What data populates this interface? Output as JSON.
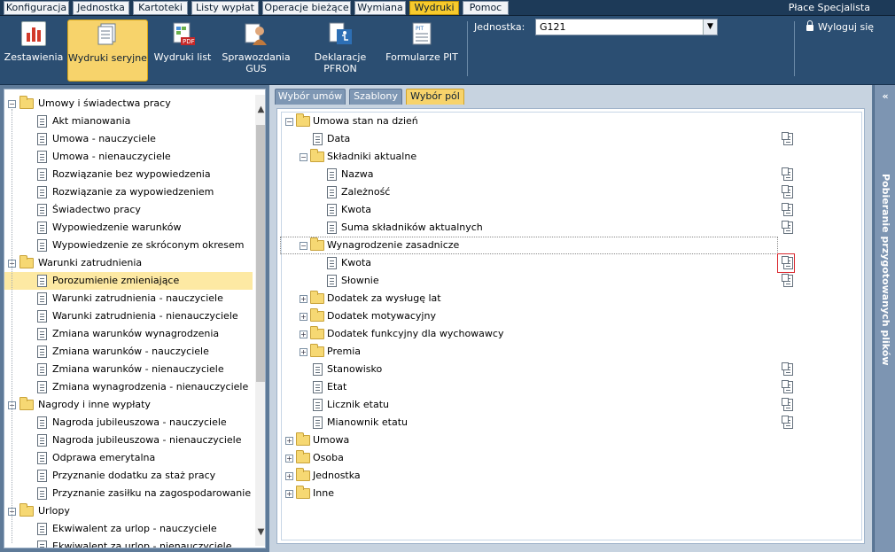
{
  "app_title": "Płace Specjalista",
  "top_menu": [
    {
      "label": "Konfiguracja",
      "active": false
    },
    {
      "label": "Jednostka",
      "active": false
    },
    {
      "label": "Kartoteki",
      "active": false
    },
    {
      "label": "Listy wypłat",
      "active": false
    },
    {
      "label": "Operacje bieżące",
      "active": false
    },
    {
      "label": "Wymiana",
      "active": false
    },
    {
      "label": "Wydruki",
      "active": true
    },
    {
      "label": "Pomoc",
      "active": false
    }
  ],
  "ribbon": {
    "buttons": [
      {
        "label": "Zestawienia",
        "icon": "bar-chart-icon",
        "active": false
      },
      {
        "label": "Wydruki seryjne",
        "icon": "document-stack-icon",
        "active": true
      },
      {
        "label": "Wydruki list",
        "icon": "pdf-document-icon",
        "active": false
      },
      {
        "label": "Sprawozdania GUS",
        "icon": "gus-report-icon",
        "active": false
      },
      {
        "label": "Deklaracje PFRON",
        "icon": "pfron-icon",
        "active": false
      },
      {
        "label": "Formularze PIT",
        "icon": "pit-form-icon",
        "active": false
      }
    ],
    "unit_label": "Jednostka:",
    "unit_value": "G121",
    "logout_label": "Wyloguj się"
  },
  "left_tree": [
    {
      "label": "Umowy i świadectwa pracy",
      "type": "folder",
      "level": 0,
      "expanded": true
    },
    {
      "label": "Akt mianowania",
      "type": "doc",
      "level": 1
    },
    {
      "label": "Umowa - nauczyciele",
      "type": "doc",
      "level": 1
    },
    {
      "label": "Umowa - nienauczyciele",
      "type": "doc",
      "level": 1
    },
    {
      "label": "Rozwiązanie bez wypowiedzenia",
      "type": "doc",
      "level": 1
    },
    {
      "label": "Rozwiązanie za wypowiedzeniem",
      "type": "doc",
      "level": 1
    },
    {
      "label": "Świadectwo pracy",
      "type": "doc",
      "level": 1
    },
    {
      "label": "Wypowiedzenie warunków",
      "type": "doc",
      "level": 1
    },
    {
      "label": "Wypowiedzenie ze skróconym okresem",
      "type": "doc",
      "level": 1
    },
    {
      "label": "Warunki zatrudnienia",
      "type": "folder",
      "level": 0,
      "expanded": true
    },
    {
      "label": "Porozumienie zmieniające",
      "type": "doc",
      "level": 1,
      "selected": true
    },
    {
      "label": "Warunki zatrudnienia - nauczyciele",
      "type": "doc",
      "level": 1
    },
    {
      "label": "Warunki zatrudnienia - nienauczyciele",
      "type": "doc",
      "level": 1
    },
    {
      "label": "Zmiana warunków wynagrodzenia",
      "type": "doc",
      "level": 1
    },
    {
      "label": "Zmiana warunków - nauczyciele",
      "type": "doc",
      "level": 1
    },
    {
      "label": "Zmiana warunków - nienauczyciele",
      "type": "doc",
      "level": 1
    },
    {
      "label": "Zmiana wynagrodzenia - nienauczyciele",
      "type": "doc",
      "level": 1
    },
    {
      "label": "Nagrody i inne wypłaty",
      "type": "folder",
      "level": 0,
      "expanded": true
    },
    {
      "label": "Nagroda jubileuszowa - nauczyciele",
      "type": "doc",
      "level": 1
    },
    {
      "label": "Nagroda jubileuszowa - nienauczyciele",
      "type": "doc",
      "level": 1
    },
    {
      "label": "Odprawa emerytalna",
      "type": "doc",
      "level": 1
    },
    {
      "label": "Przyznanie dodatku za staż pracy",
      "type": "doc",
      "level": 1
    },
    {
      "label": "Przyznanie zasiłku na zagospodarowanie",
      "type": "doc",
      "level": 1
    },
    {
      "label": "Urlopy",
      "type": "folder",
      "level": 0,
      "expanded": true
    },
    {
      "label": "Ekwiwalent za urlop - nauczyciele",
      "type": "doc",
      "level": 1
    },
    {
      "label": "Ekwiwalent za urlop - nienauczyciele",
      "type": "doc",
      "level": 1
    }
  ],
  "right_tabs": [
    {
      "label": "Wybór umów",
      "active": false
    },
    {
      "label": "Szablony",
      "active": false
    },
    {
      "label": "Wybór pól",
      "active": true
    }
  ],
  "right_tree": [
    {
      "label": "Umowa stan na dzień",
      "type": "folder",
      "level": 0,
      "expanded": true
    },
    {
      "label": "Data",
      "type": "doc",
      "level": 1,
      "action": true
    },
    {
      "label": "Składniki aktualne",
      "type": "folder",
      "level": 1,
      "expanded": true
    },
    {
      "label": "Nazwa",
      "type": "doc",
      "level": 2,
      "action": true
    },
    {
      "label": "Zależność",
      "type": "doc",
      "level": 2,
      "action": true
    },
    {
      "label": "Kwota",
      "type": "doc",
      "level": 2,
      "action": true
    },
    {
      "label": "Suma składników aktualnych",
      "type": "doc",
      "level": 2,
      "action": true
    },
    {
      "label": "Wynagrodzenie zasadnicze",
      "type": "folder",
      "level": 1,
      "expanded": true,
      "focused": true
    },
    {
      "label": "Kwota",
      "type": "doc",
      "level": 2,
      "action": true,
      "highlight_action": true
    },
    {
      "label": "Słownie",
      "type": "doc",
      "level": 2,
      "action": true
    },
    {
      "label": "Dodatek za wysługę lat",
      "type": "folder",
      "level": 1,
      "expanded": false
    },
    {
      "label": "Dodatek motywacyjny",
      "type": "folder",
      "level": 1,
      "expanded": false
    },
    {
      "label": "Dodatek funkcyjny dla wychowawcy",
      "type": "folder",
      "level": 1,
      "expanded": false
    },
    {
      "label": "Premia",
      "type": "folder",
      "level": 1,
      "expanded": false
    },
    {
      "label": "Stanowisko",
      "type": "doc",
      "level": 1,
      "action": true
    },
    {
      "label": "Etat",
      "type": "doc",
      "level": 1,
      "action": true
    },
    {
      "label": "Licznik etatu",
      "type": "doc",
      "level": 1,
      "action": true
    },
    {
      "label": "Mianownik etatu",
      "type": "doc",
      "level": 1,
      "action": true
    },
    {
      "label": "Umowa",
      "type": "folder",
      "level": 0,
      "expanded": false
    },
    {
      "label": "Osoba",
      "type": "folder",
      "level": 0,
      "expanded": false
    },
    {
      "label": "Jednostka",
      "type": "folder",
      "level": 0,
      "expanded": false
    },
    {
      "label": "Inne",
      "type": "folder",
      "level": 0,
      "expanded": false
    }
  ],
  "side_panel": {
    "label": "Pobieranie przygotowanych plików",
    "collapse_glyph": "«"
  }
}
